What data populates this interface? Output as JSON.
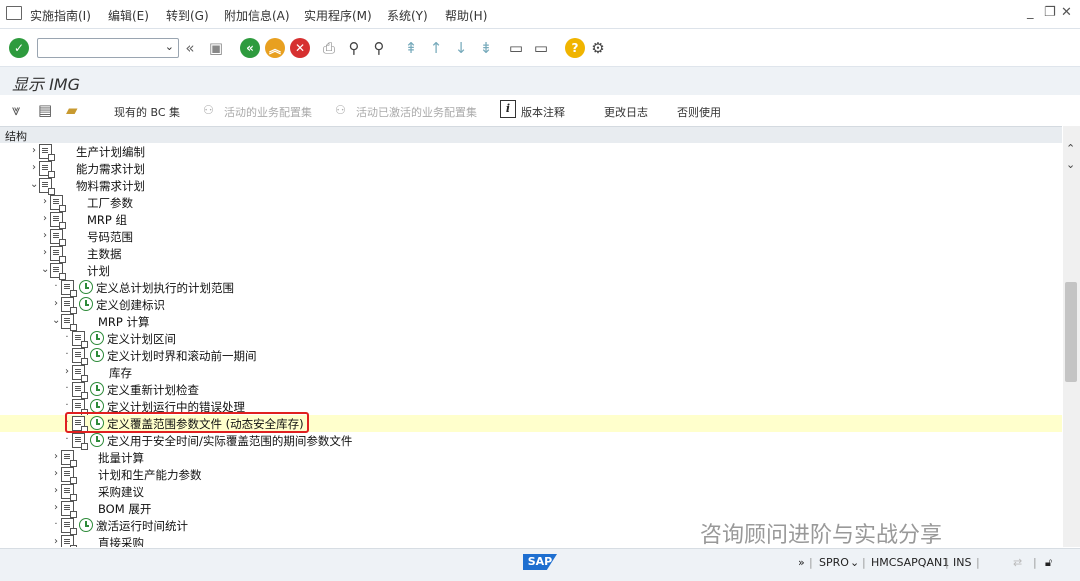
{
  "menu": {
    "items": [
      "实施指南(I)",
      "编辑(E)",
      "转到(G)",
      "附加信息(A)",
      "实用程序(M)",
      "系统(Y)",
      "帮助(H)"
    ]
  },
  "window_controls": [
    "_",
    "❐",
    "✕"
  ],
  "toolbar": {
    "command_value": ""
  },
  "title": "显示 IMG",
  "app_toolbar": {
    "current_bc_set": "现有的 BC 集",
    "active_business_config_set": "活动的业务配置集",
    "activated_business_config_set": "活动已激活的业务配置集",
    "release_notes": "版本注释",
    "change_log": "更改日志",
    "whether_used": "否则使用"
  },
  "structure_header": "结构",
  "tree": [
    {
      "label": "生产计划编制",
      "level": 0,
      "exp": "›",
      "clock": false
    },
    {
      "label": "能力需求计划",
      "level": 0,
      "exp": "›",
      "clock": false
    },
    {
      "label": "物料需求计划",
      "level": 0,
      "exp": "⌄",
      "clock": false
    },
    {
      "label": "工厂参数",
      "level": 1,
      "exp": "›",
      "clock": false
    },
    {
      "label": "MRP 组",
      "level": 1,
      "exp": "›",
      "clock": false
    },
    {
      "label": "号码范围",
      "level": 1,
      "exp": "›",
      "clock": false
    },
    {
      "label": "主数据",
      "level": 1,
      "exp": "›",
      "clock": false
    },
    {
      "label": "计划",
      "level": 1,
      "exp": "⌄",
      "clock": false
    },
    {
      "label": "定义总计划执行的计划范围",
      "level": 2,
      "exp": "·",
      "clock": true
    },
    {
      "label": "定义创建标识",
      "level": 2,
      "exp": "›",
      "clock": true
    },
    {
      "label": "MRP 计算",
      "level": 2,
      "exp": "⌄",
      "clock": false
    },
    {
      "label": "定义计划区间",
      "level": 3,
      "exp": "·",
      "clock": true
    },
    {
      "label": "定义计划时界和滚动前一期间",
      "level": 3,
      "exp": "·",
      "clock": true
    },
    {
      "label": "库存",
      "level": 3,
      "exp": "›",
      "clock": false
    },
    {
      "label": "定义重新计划检查",
      "level": 3,
      "exp": "·",
      "clock": true
    },
    {
      "label": "定义计划运行中的错误处理",
      "level": 3,
      "exp": "·",
      "clock": true
    },
    {
      "label": "定义覆盖范围参数文件 (动态安全库存)",
      "level": 3,
      "exp": "·",
      "clock": true,
      "highlight": true
    },
    {
      "label": "定义用于安全时间/实际覆盖范围的期间参数文件",
      "level": 3,
      "exp": "·",
      "clock": true
    },
    {
      "label": "批量计算",
      "level": 2,
      "exp": "›",
      "clock": false
    },
    {
      "label": "计划和生产能力参数",
      "level": 2,
      "exp": "›",
      "clock": false
    },
    {
      "label": "采购建议",
      "level": 2,
      "exp": "›",
      "clock": false
    },
    {
      "label": "BOM 展开",
      "level": 2,
      "exp": "›",
      "clock": false
    },
    {
      "label": "激活运行时间统计",
      "level": 2,
      "exp": "·",
      "clock": true
    },
    {
      "label": "直接采购",
      "level": 2,
      "exp": "›",
      "clock": false
    }
  ],
  "status_bar": {
    "sap_logo": "SAP",
    "transaction": "SPRO",
    "system": "HMCSAPQAN1",
    "mode": "INS"
  },
  "watermark": "咨询顾问进阶与实战分享"
}
